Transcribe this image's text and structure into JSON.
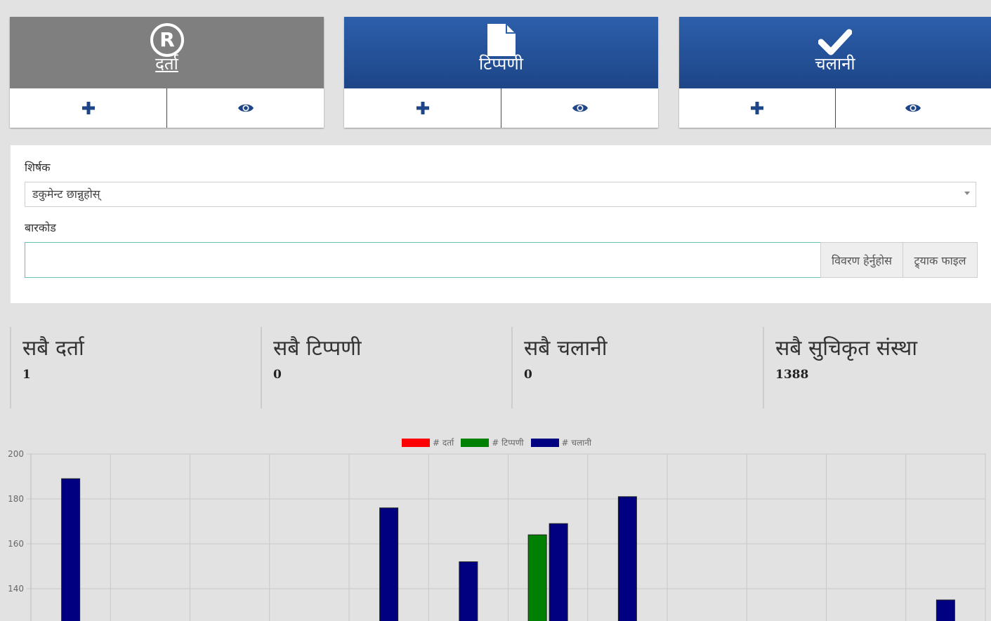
{
  "cards": [
    {
      "title": "दर्ता",
      "icon": "registered-icon",
      "style": "gray",
      "add_icon": "plus-icon",
      "view_icon": "eye-icon"
    },
    {
      "title": "टिप्पणी",
      "icon": "document-icon",
      "style": "blue",
      "add_icon": "plus-icon",
      "view_icon": "eye-icon"
    },
    {
      "title": "चलानी",
      "icon": "check-icon",
      "style": "blue",
      "add_icon": "plus-icon",
      "view_icon": "eye-icon"
    }
  ],
  "form": {
    "title_label": "शिर्षक",
    "title_select_value": "डकुमेन्ट छान्नुहोस्",
    "barcode_label": "बारकोड",
    "barcode_value": "",
    "view_details_button": "विवरण हेर्नुहोस",
    "track_file_button": "ट्र्याक फाइल"
  },
  "stats": [
    {
      "title": "सबै दर्ता",
      "value": "1"
    },
    {
      "title": "सबै टिप्पणी",
      "value": "0"
    },
    {
      "title": "सबै चलानी",
      "value": "0"
    },
    {
      "title": "सबै सुचिकृत संस्था",
      "value": "1388"
    }
  ],
  "colors": {
    "darta": "#ff0000",
    "tippani": "#008000",
    "chalani": "#000080",
    "accent": "#1d4587"
  },
  "chart_data": {
    "type": "bar",
    "legend": [
      "# दर्ता",
      "# टिप्पणी",
      "# चलानी"
    ],
    "yticks": [
      200,
      180,
      160,
      140
    ],
    "ylim_visible": [
      130,
      200
    ],
    "num_slots": 12,
    "series": [
      {
        "name": "# दर्ता",
        "values": [
          null,
          null,
          null,
          null,
          null,
          null,
          null,
          null,
          null,
          null,
          null,
          null
        ]
      },
      {
        "name": "# टिप्पणी",
        "values": [
          null,
          null,
          null,
          null,
          null,
          null,
          164,
          null,
          null,
          null,
          null,
          null
        ]
      },
      {
        "name": "# चलानी",
        "values": [
          189,
          null,
          null,
          null,
          176,
          152,
          169,
          181,
          null,
          null,
          null,
          135
        ]
      }
    ]
  }
}
